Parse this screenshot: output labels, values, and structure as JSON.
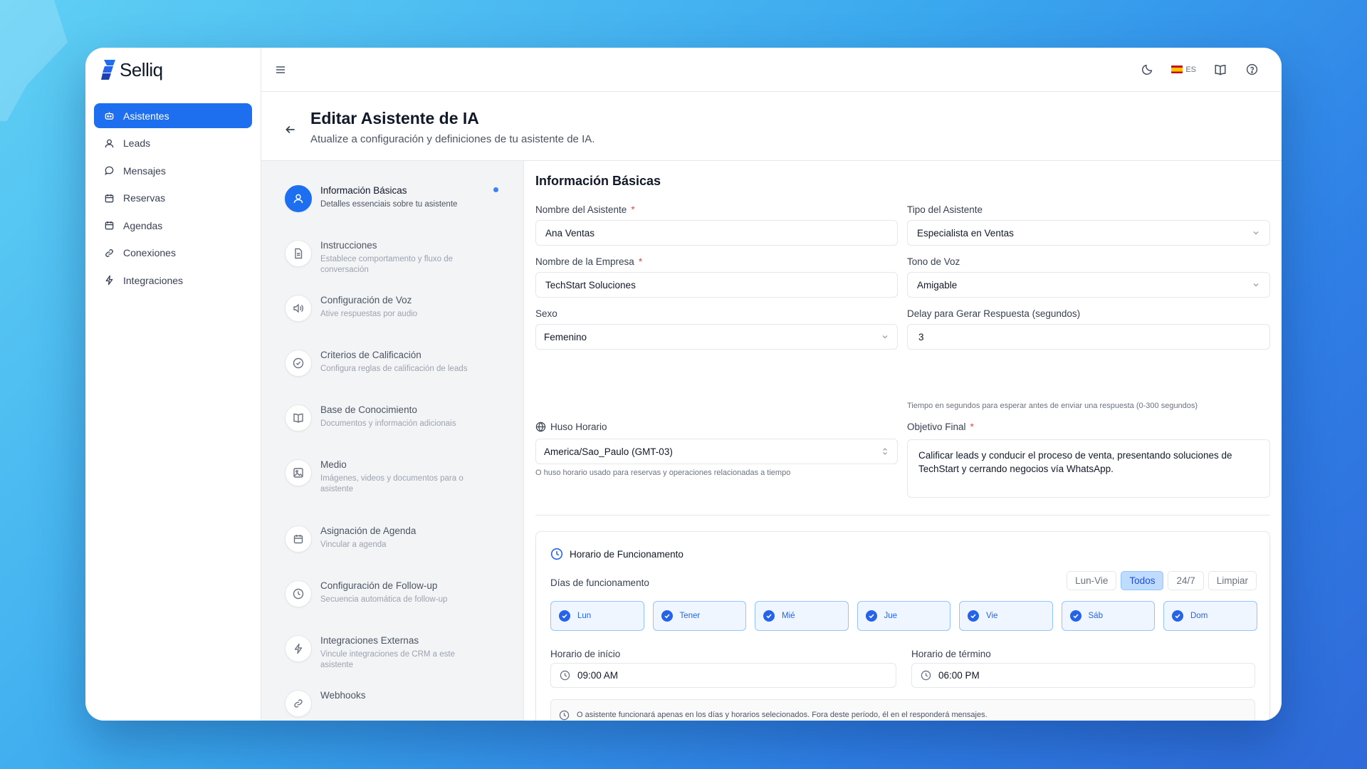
{
  "app": {
    "name": "Selliq"
  },
  "sidebar": {
    "items": [
      {
        "label": "Asistentes",
        "icon": "bot-icon",
        "active": true
      },
      {
        "label": "Leads",
        "icon": "user-icon"
      },
      {
        "label": "Mensajes",
        "icon": "message-icon"
      },
      {
        "label": "Reservas",
        "icon": "calendar-icon"
      },
      {
        "label": "Agendas",
        "icon": "calendar-icon"
      },
      {
        "label": "Conexiones",
        "icon": "link-icon"
      },
      {
        "label": "Integraciones",
        "icon": "bolt-icon"
      }
    ]
  },
  "topbar": {
    "language": "ES"
  },
  "header": {
    "title": "Editar Asistente de IA",
    "subtitle": "Atualize a configuración y definiciones de tu asistente de IA."
  },
  "steps": [
    {
      "title": "Información Básicas",
      "desc": "Detalles essenciais sobre tu asistente",
      "icon": "user-icon",
      "active": true
    },
    {
      "title": "Instrucciones",
      "desc": "Establece comportamento y fluxo de conversación",
      "icon": "document-icon"
    },
    {
      "title": "Configuración de Voz",
      "desc": "Ative respuestas por audio",
      "icon": "speaker-icon"
    },
    {
      "title": "Criterios de Calificación",
      "desc": "Configura reglas de calificación de leads",
      "icon": "check-circle-icon"
    },
    {
      "title": "Base de Conocimiento",
      "desc": "Documentos y información adicionais",
      "icon": "book-icon"
    },
    {
      "title": "Medio",
      "desc": "Imágenes, videos y documentos para o asistente",
      "icon": "image-icon"
    },
    {
      "title": "Asignación de Agenda",
      "desc": "Vincular a agenda",
      "icon": "calendar-icon"
    },
    {
      "title": "Configuración de Follow-up",
      "desc": "Secuencia automática de follow-up",
      "icon": "clock-icon"
    },
    {
      "title": "Integraciones Externas",
      "desc": "Vincule integraciones de CRM a este asistente",
      "icon": "bolt-icon"
    },
    {
      "title": "Webhooks",
      "desc": "",
      "icon": "link-icon"
    }
  ],
  "form": {
    "section_title": "Información Básicas",
    "assistant_name": {
      "label": "Nombre del Asistente",
      "value": "Ana Ventas"
    },
    "assistant_type": {
      "label": "Tipo del Asistente",
      "value": "Especialista en Ventas"
    },
    "company_name": {
      "label": "Nombre de la Empresa",
      "value": "TechStart Soluciones"
    },
    "tone": {
      "label": "Tono de Voz",
      "value": "Amigable"
    },
    "gender": {
      "label": "Sexo",
      "value": "Femenino"
    },
    "delay": {
      "label": "Delay para Gerar Respuesta (segundos)",
      "value": "3",
      "hint": "Tiempo en segundos para esperar antes de enviar una respuesta (0-300 segundos)"
    },
    "timezone": {
      "label": "Huso Horario",
      "value": "America/Sao_Paulo (GMT-03)",
      "hint": "O huso horario usado para reservas y operaciones relacionadas a tiempo"
    },
    "goal": {
      "label": "Objetivo Final",
      "value": "Calificar leads y conducir el proceso de venta, presentando soluciones de TechStart y cerrando negocios vía WhatsApp."
    }
  },
  "schedule": {
    "title": "Horario de Funcionamento",
    "days_label": "Días de funcionamento",
    "quick": [
      {
        "label": "Lun-Vie",
        "active": false
      },
      {
        "label": "Todos",
        "active": true
      },
      {
        "label": "24/7",
        "active": false
      },
      {
        "label": "Limpiar",
        "active": false
      }
    ],
    "days": [
      {
        "label": "Lun",
        "checked": true
      },
      {
        "label": "Tener",
        "checked": true
      },
      {
        "label": "Mié",
        "checked": true
      },
      {
        "label": "Jue",
        "checked": true
      },
      {
        "label": "Vie",
        "checked": true
      },
      {
        "label": "Sáb",
        "checked": true
      },
      {
        "label": "Dom",
        "checked": true
      }
    ],
    "start_label": "Horario de início",
    "start_value": "09:00 AM",
    "end_label": "Horario de término",
    "end_value": "06:00 PM",
    "note": "O asistente funcionará apenas en los días y horarios selecionados. Fora deste período, él en el responderá mensajes."
  },
  "colors": {
    "accent": "#1d6ff0",
    "required": "#ef4444"
  }
}
